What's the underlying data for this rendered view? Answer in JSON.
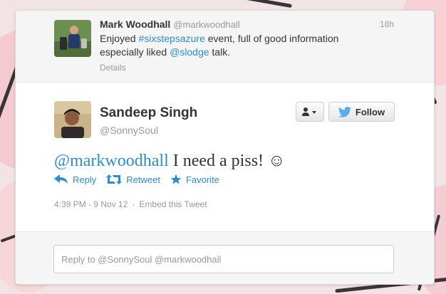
{
  "parent_tweet": {
    "name": "Mark Woodhall",
    "handle": "@markwoodhall",
    "time": "18h",
    "text_1": "Enjoyed ",
    "hashtag": "#sixstepsazure",
    "text_2": " event, full of good information especially liked ",
    "mention": "@slodge",
    "text_3": " talk.",
    "details_label": "Details"
  },
  "main_tweet": {
    "full_name": "Sandeep Singh",
    "screen_name": "@SonnySoul",
    "mention": "@markwoodhall",
    "text": " I need a piss! ☺",
    "follow_label": "Follow",
    "actions": {
      "reply": "Reply",
      "retweet": "Retweet",
      "favorite": "Favorite"
    },
    "timestamp": "4:39 PM - 9 Nov 12",
    "separator": "·",
    "embed_label": "Embed this Tweet"
  },
  "reply_box": {
    "placeholder": "Reply to @SonnySoul @markwoodhall"
  },
  "colors": {
    "link": "#2a8dcc",
    "twitter_bird": "#55acee"
  },
  "icons": {
    "user_menu": "user-dropdown-icon",
    "bird": "twitter-bird-icon",
    "reply": "reply-arrow-icon",
    "retweet": "retweet-icon",
    "favorite": "star-icon"
  }
}
